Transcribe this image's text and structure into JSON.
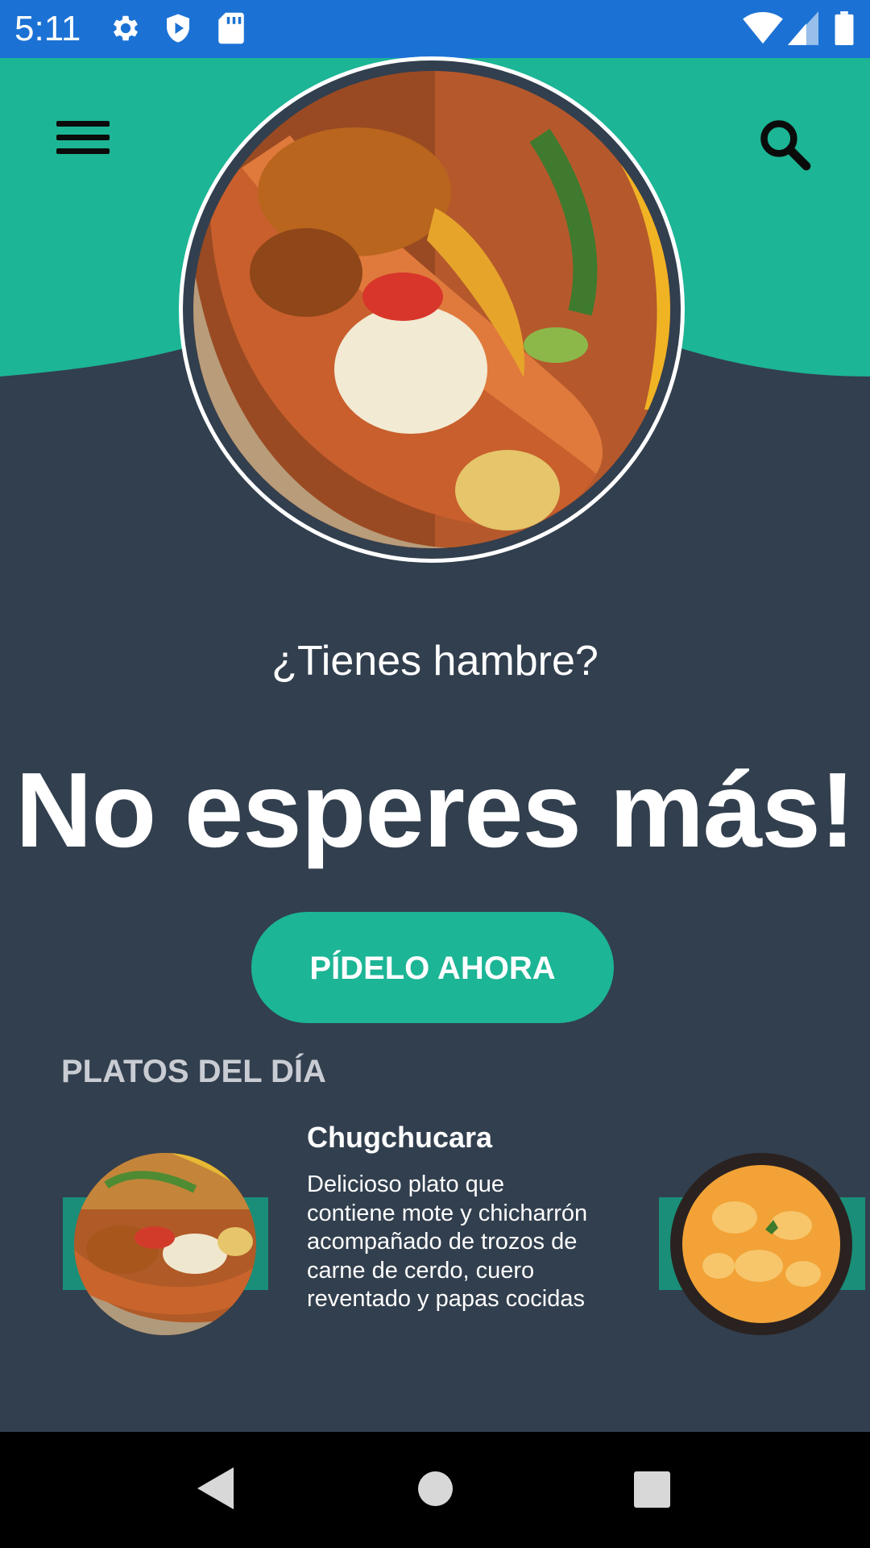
{
  "status_bar": {
    "time": "5:11",
    "icons": [
      "gear-icon",
      "shield-icon",
      "sd-card-icon",
      "wifi-icon",
      "signal-icon",
      "battery-icon"
    ]
  },
  "header": {
    "menu_icon": "hamburger-menu-icon",
    "search_icon": "search-icon",
    "accent_color": "#1cb595",
    "background_color": "#323f4e"
  },
  "hero": {
    "question": "¿Tienes hambre?",
    "headline": "No esperes más!",
    "cta_label": "PÍDELO AHORA"
  },
  "section": {
    "title": "PLATOS DEL DÍA"
  },
  "dishes": [
    {
      "name": "Chugchucara",
      "description": "Delicioso plato que contiene mote y chicharrón acompañado de trozos de carne de cerdo, cuero reventado y papas cocidas"
    }
  ],
  "nav_bar": {
    "buttons": [
      "back-icon",
      "home-icon",
      "recents-icon"
    ]
  }
}
